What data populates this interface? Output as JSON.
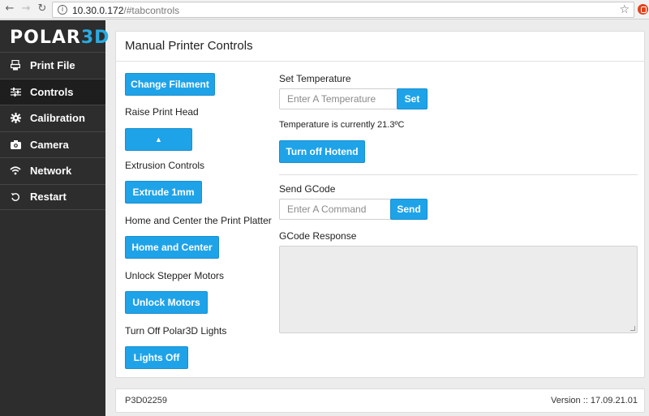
{
  "browser": {
    "url_host": "10.30.0.172",
    "url_path": "/#tabcontrols",
    "back_icon": "←",
    "forward_icon": "→",
    "reload_icon": "↻",
    "info_icon": "i",
    "star_icon": "☆"
  },
  "brand": {
    "part1": "POLAR",
    "part2": "3D"
  },
  "sidebar": {
    "items": [
      {
        "label": "Print File",
        "icon": "printer-icon"
      },
      {
        "label": "Controls",
        "icon": "sliders-icon",
        "active": true
      },
      {
        "label": "Calibration",
        "icon": "gear-icon"
      },
      {
        "label": "Camera",
        "icon": "camera-icon"
      },
      {
        "label": "Network",
        "icon": "wifi-icon"
      },
      {
        "label": "Restart",
        "icon": "restart-icon"
      }
    ]
  },
  "panel": {
    "title": "Manual Printer Controls",
    "left": {
      "change_filament": "Change Filament",
      "raise_label": "Raise Print Head",
      "raise_button": "▲",
      "extrusion_label": "Extrusion Controls",
      "extrude_button": "Extrude 1mm",
      "home_label": "Home and Center the Print Platter",
      "home_button": "Home and Center",
      "unlock_label": "Unlock Stepper Motors",
      "unlock_button": "Unlock Motors",
      "lights_label": "Turn Off Polar3D Lights",
      "lights_button": "Lights Off"
    },
    "right": {
      "temp_label": "Set Temperature",
      "temp_placeholder": "Enter A Temperature",
      "temp_set_button": "Set",
      "temp_status": "Temperature is currently 21.3ºC",
      "hotend_button": "Turn off Hotend",
      "gcode_label": "Send GCode",
      "gcode_placeholder": "Enter A Command",
      "gcode_send_button": "Send",
      "response_label": "GCode Response"
    }
  },
  "footer": {
    "serial": "P3D02259",
    "version": "Version :: 17.09.21.01"
  },
  "colors": {
    "accent": "#1fa3e8",
    "sidebar_bg": "#2d2d2d",
    "brand_blue": "#29abe2"
  }
}
